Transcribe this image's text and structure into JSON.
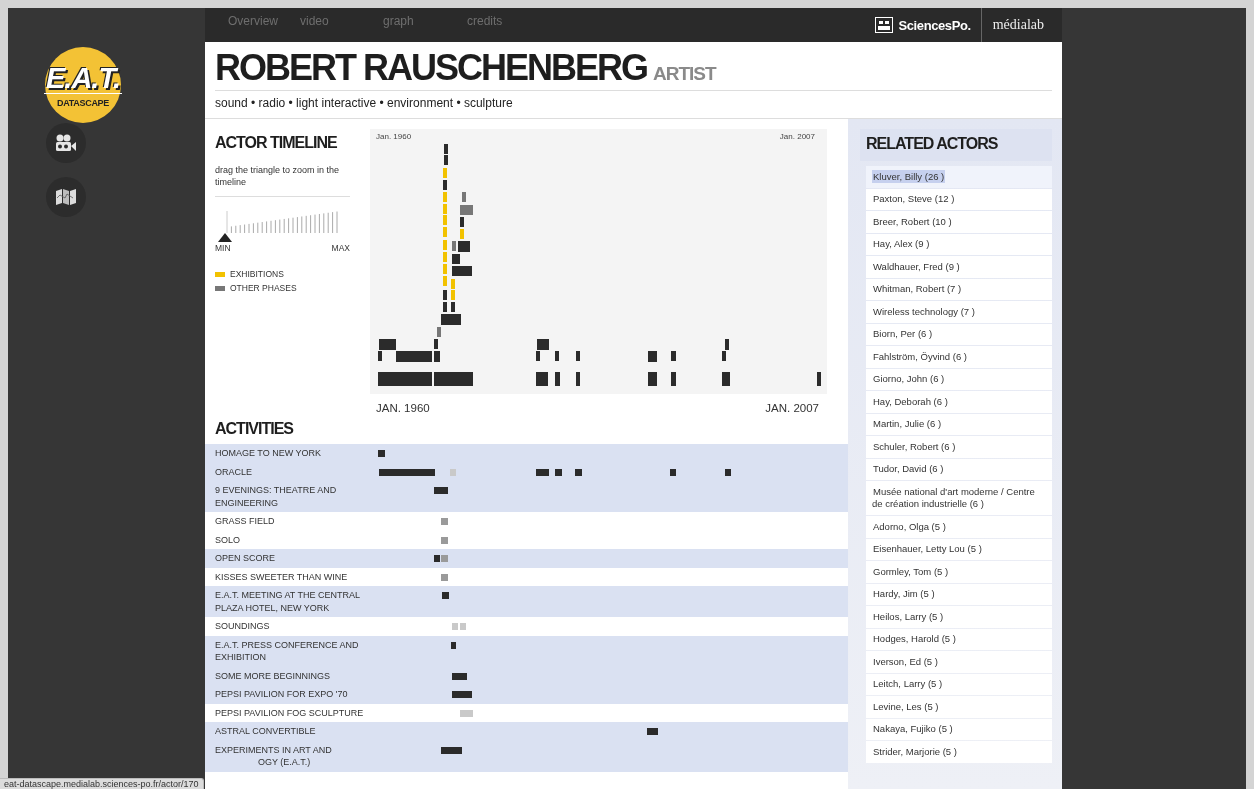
{
  "sidebar": {
    "logo_title": "E.A.T.",
    "logo_subtitle": "DATASCAPE",
    "icons": [
      {
        "kind": "video"
      },
      {
        "kind": "map"
      }
    ]
  },
  "nav": {
    "links": [
      {
        "label": "Overview"
      },
      {
        "label": "video"
      },
      {
        "label": "graph"
      },
      {
        "label": "credits"
      }
    ],
    "partner_logo": "SciencesPo.",
    "partner_lab": "médialab"
  },
  "header": {
    "name": "ROBERT RAUSCHENBERG",
    "role": "ARTIST",
    "tags": "sound • radio • light interactive • environment • sculpture"
  },
  "actor_timeline": {
    "title": "ACTOR TIMELINE",
    "hint": "drag the triangle to zoom in the timeline",
    "zoom_slider": {
      "level": 0,
      "min_label": "MIN",
      "max_label": "MAX"
    },
    "legend": [
      {
        "label": "EXHIBITIONS",
        "color": "#f2c200"
      },
      {
        "label": "OTHER PHASES",
        "color": "#777777"
      }
    ],
    "chart_top_start": "Jan. 1960",
    "chart_top_end": "Jan. 2007",
    "axis_start": "JAN. 1960",
    "axis_end": "JAN. 2007"
  },
  "activities": {
    "title": "ACTIVITIES",
    "rows": [
      {
        "label": "HOMAGE TO NEW YORK",
        "shaded": true
      },
      {
        "label": "ORACLE",
        "shaded": true
      },
      {
        "label": "9 EVENINGS: THEATRE AND ENGINEERING",
        "shaded": true
      },
      {
        "label": "GRASS FIELD",
        "shaded": false
      },
      {
        "label": "SOLO",
        "shaded": false
      },
      {
        "label": "OPEN SCORE",
        "shaded": true
      },
      {
        "label": "KISSES SWEETER THAN WINE",
        "shaded": false
      },
      {
        "label": "E.A.T. MEETING AT THE CENTRAL PLAZA HOTEL, NEW YORK",
        "shaded": true
      },
      {
        "label": "SOUNDINGS",
        "shaded": false
      },
      {
        "label": "E.A.T. PRESS CONFERENCE AND EXHIBITION",
        "shaded": true
      },
      {
        "label": "SOME MORE BEGINNINGS",
        "shaded": true
      },
      {
        "label": "PEPSI PAVILION FOR EXPO '70",
        "shaded": true
      },
      {
        "label": "PEPSI PAVILION FOG SCULPTURE",
        "shaded": false
      },
      {
        "label": "ASTRAL CONVERTIBLE",
        "shaded": true
      },
      {
        "label": "EXPERIMENTS IN ART AND",
        "label_line_2": "OGY (E.A.T.)",
        "shaded": true
      }
    ]
  },
  "related_actors": {
    "title": "RELATED ACTORS",
    "items": [
      {
        "label": "Kluver, Billy (26 )",
        "selected": true
      },
      {
        "label": "Paxton, Steve (12 )",
        "selected": false
      },
      {
        "label": "Breer, Robert (10 )",
        "selected": false
      },
      {
        "label": "Hay, Alex (9 )",
        "selected": false
      },
      {
        "label": "Waldhauer, Fred (9 )",
        "selected": false
      },
      {
        "label": "Whitman, Robert (7 )",
        "selected": false
      },
      {
        "label": "Wireless technology (7 )",
        "selected": false
      },
      {
        "label": "Biorn, Per (6 )",
        "selected": false
      },
      {
        "label": "Fahlström, Öyvind (6 )",
        "selected": false
      },
      {
        "label": "Giorno, John (6 )",
        "selected": false
      },
      {
        "label": "Hay, Deborah (6 )",
        "selected": false
      },
      {
        "label": "Martin, Julie (6 )",
        "selected": false
      },
      {
        "label": "Schuler, Robert (6 )",
        "selected": false
      },
      {
        "label": "Tudor, David (6 )",
        "selected": false
      },
      {
        "label": "Musée national d'art moderne / Centre de création industrielle (6 )",
        "selected": false
      },
      {
        "label": "Adorno, Olga (5 )",
        "selected": false
      },
      {
        "label": "Eisenhauer, Letty Lou (5 )",
        "selected": false
      },
      {
        "label": "Gormley, Tom (5 )",
        "selected": false
      },
      {
        "label": "Hardy, Jim (5 )",
        "selected": false
      },
      {
        "label": "Heilos, Larry (5 )",
        "selected": false
      },
      {
        "label": "Hodges, Harold (5 )",
        "selected": false
      },
      {
        "label": "Iverson, Ed (5 )",
        "selected": false
      },
      {
        "label": "Leitch, Larry (5 )",
        "selected": false
      },
      {
        "label": "Levine, Les (5 )",
        "selected": false
      },
      {
        "label": "Nakaya, Fujiko (5 )",
        "selected": false
      },
      {
        "label": "Strider, Marjorie (5 )",
        "selected": false
      }
    ]
  },
  "status_bar": {
    "url": "eat-datascape.medialab.sciences-po.fr/actor/170"
  }
}
